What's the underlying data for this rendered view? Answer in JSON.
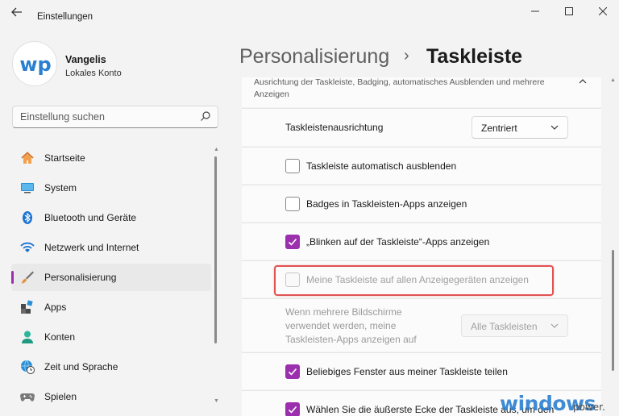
{
  "window": {
    "title": "Einstellungen",
    "back_icon": "arrow-left-icon",
    "minimize_glyph": "—",
    "maximize_glyph": "☐",
    "close_glyph": "✕"
  },
  "profile": {
    "avatar_text": "wp",
    "name": "Vangelis",
    "account_type": "Lokales Konto"
  },
  "search": {
    "placeholder": "Einstellung suchen",
    "icon": "search-icon"
  },
  "sidebar": {
    "items": [
      {
        "label": "Startseite",
        "icon": "home-icon",
        "active": false
      },
      {
        "label": "System",
        "icon": "monitor-icon",
        "active": false
      },
      {
        "label": "Bluetooth und Geräte",
        "icon": "bluetooth-icon",
        "active": false
      },
      {
        "label": "Netzwerk und Internet",
        "icon": "wifi-icon",
        "active": false
      },
      {
        "label": "Personalisierung",
        "icon": "brush-icon",
        "active": true
      },
      {
        "label": "Apps",
        "icon": "apps-icon",
        "active": false
      },
      {
        "label": "Konten",
        "icon": "person-icon",
        "active": false
      },
      {
        "label": "Zeit und Sprache",
        "icon": "globe-clock-icon",
        "active": false
      },
      {
        "label": "Spielen",
        "icon": "gamepad-icon",
        "active": false
      }
    ]
  },
  "header": {
    "breadcrumb_parent": "Personalisierung",
    "breadcrumb_separator": "›",
    "breadcrumb_current": "Taskleiste"
  },
  "group": {
    "description": "Ausrichtung der Taskleiste, Badging, automatisches Ausblenden und mehrere Anzeigen",
    "collapse_glyph": "⌃"
  },
  "settings": {
    "alignment_label": "Taskleistenausrichtung",
    "alignment_value": "Zentriert",
    "autohide_label": "Taskleiste automatisch ausblenden",
    "autohide_checked": false,
    "badges_label": "Badges in Taskleisten-Apps anzeigen",
    "badges_checked": false,
    "flashing_label": "„Blinken auf der Taskleiste“-Apps anzeigen",
    "flashing_checked": true,
    "all_displays_label": "Meine Taskleiste auf allen Anzeigegeräten anzeigen",
    "all_displays_checked": false,
    "multi_display_desc": "Wenn mehrere Bildschirme verwendet werden, meine Taskleisten-Apps anzeigen auf",
    "multi_display_value": "Alle Taskleisten",
    "share_window_label": "Beliebiges Fenster aus meiner Taskleiste teilen",
    "share_window_checked": true,
    "far_corner_label": "Wählen Sie die äußerste Ecke der Taskleiste aus, um den",
    "far_corner_checked": true
  },
  "watermark": {
    "main": "windows",
    "sub": "power."
  },
  "colors": {
    "accent": "#9b2fae",
    "highlight_border": "#e05252",
    "watermark": "#2b7fd0"
  }
}
